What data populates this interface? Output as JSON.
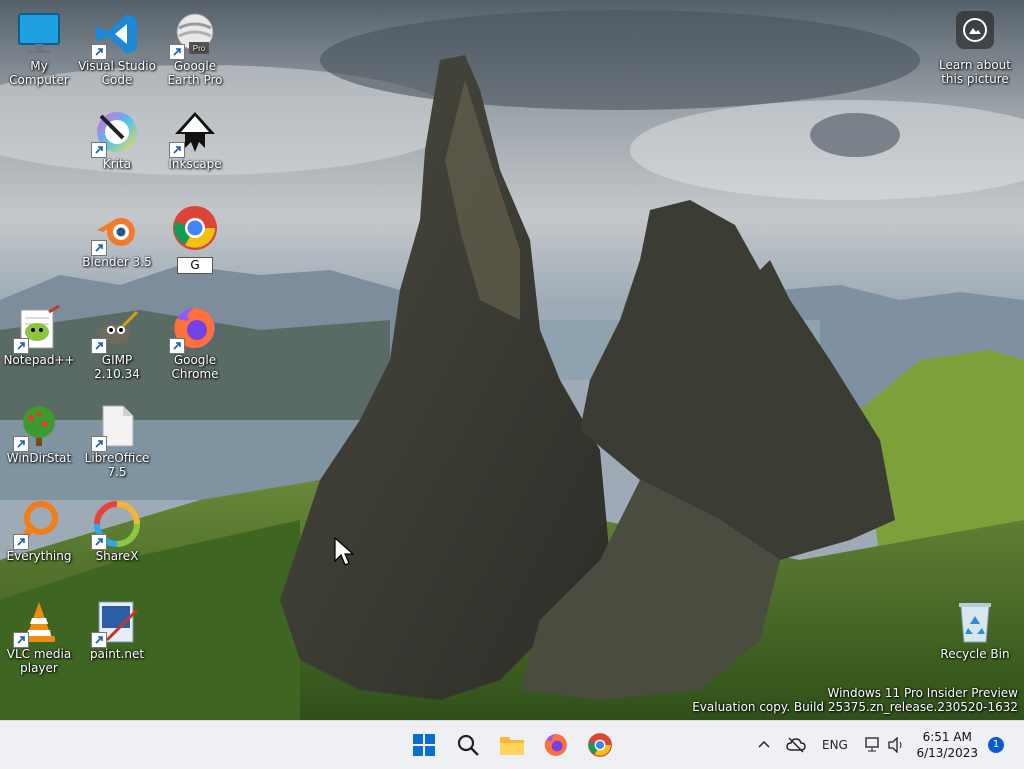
{
  "desktop": {
    "icons": [
      {
        "label": "My Computer",
        "icon": "monitor-icon"
      },
      {
        "label": "Visual Studio Code",
        "icon": "vscode-icon"
      },
      {
        "label": "Google Earth Pro",
        "icon": "google-earth-icon",
        "badge": "Pro"
      },
      {
        "label": "Krita",
        "icon": "krita-icon"
      },
      {
        "label": "Inkscape",
        "icon": "inkscape-icon"
      },
      {
        "label": "Blender 3.5",
        "icon": "blender-icon"
      },
      {
        "label": "G",
        "icon": "chrome-icon",
        "renaming": true
      },
      {
        "label": "Notepad++",
        "icon": "notepadpp-icon"
      },
      {
        "label": "GIMP 2.10.34",
        "icon": "gimp-icon"
      },
      {
        "label": "Google Chrome",
        "icon": "firefox-icon"
      },
      {
        "label": "WinDirStat",
        "icon": "windirstat-icon"
      },
      {
        "label": "LibreOffice 7.5",
        "icon": "libreoffice-icon"
      },
      {
        "label": "Everything",
        "icon": "everything-icon"
      },
      {
        "label": "ShareX",
        "icon": "sharex-icon"
      },
      {
        "label": "VLC media player",
        "icon": "vlc-icon"
      },
      {
        "label": "paint.net",
        "icon": "paintnet-icon"
      },
      {
        "label": "Recycle Bin",
        "icon": "recycle-bin-icon"
      }
    ],
    "learn_about": "Learn about this picture",
    "watermark": {
      "line1": "Windows 11 Pro Insider Preview",
      "line2": "Evaluation copy. Build 25375.zn_release.230520-1632"
    }
  },
  "taskbar": {
    "apps": [
      "start-icon",
      "search-icon",
      "file-explorer-icon",
      "firefox-icon",
      "chrome-icon"
    ],
    "tray": {
      "language": "ENG",
      "time": "6:51 AM",
      "date": "6/13/2023",
      "notification_count": "1"
    }
  },
  "colors": {
    "taskbar_bg": "#eef0f3",
    "accent": "#0a5bd3"
  }
}
